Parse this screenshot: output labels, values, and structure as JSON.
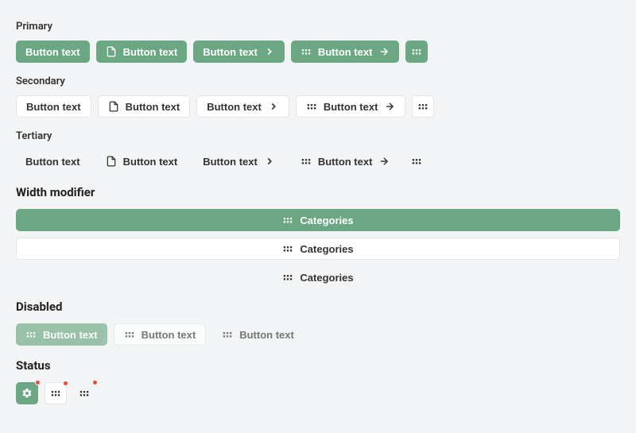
{
  "colors": {
    "primary": "#6ba783",
    "badge": "#e74c3c"
  },
  "sections": {
    "primary": {
      "label": "Primary",
      "buttons": {
        "b1": "Button text",
        "b2": "Button text",
        "b3": "Button text",
        "b4": "Button text"
      }
    },
    "secondary": {
      "label": "Secondary",
      "buttons": {
        "b1": "Button text",
        "b2": "Button text",
        "b3": "Button text",
        "b4": "Button text"
      }
    },
    "tertiary": {
      "label": "Tertiary",
      "buttons": {
        "b1": "Button text",
        "b2": "Button text",
        "b3": "Button text",
        "b4": "Button text"
      }
    },
    "width": {
      "label": "Width modifier",
      "buttons": {
        "b1": "Categories",
        "b2": "Categories",
        "b3": "Categories"
      }
    },
    "disabled": {
      "label": "Disabled",
      "buttons": {
        "b1": "Button text",
        "b2": "Button text",
        "b3": "Button text"
      }
    },
    "status": {
      "label": "Status"
    }
  }
}
